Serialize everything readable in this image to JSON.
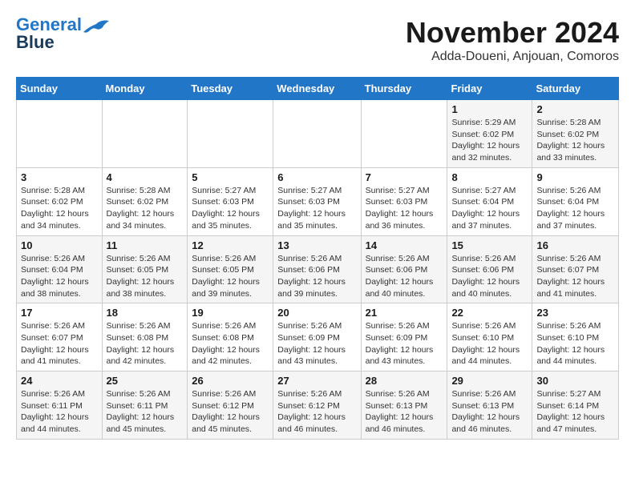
{
  "header": {
    "logo_line1": "General",
    "logo_line2": "Blue",
    "month_title": "November 2024",
    "location": "Adda-Doueni, Anjouan, Comoros"
  },
  "days_of_week": [
    "Sunday",
    "Monday",
    "Tuesday",
    "Wednesday",
    "Thursday",
    "Friday",
    "Saturday"
  ],
  "weeks": [
    [
      {
        "day": "",
        "info": ""
      },
      {
        "day": "",
        "info": ""
      },
      {
        "day": "",
        "info": ""
      },
      {
        "day": "",
        "info": ""
      },
      {
        "day": "",
        "info": ""
      },
      {
        "day": "1",
        "info": "Sunrise: 5:29 AM\nSunset: 6:02 PM\nDaylight: 12 hours and 32 minutes."
      },
      {
        "day": "2",
        "info": "Sunrise: 5:28 AM\nSunset: 6:02 PM\nDaylight: 12 hours and 33 minutes."
      }
    ],
    [
      {
        "day": "3",
        "info": "Sunrise: 5:28 AM\nSunset: 6:02 PM\nDaylight: 12 hours and 34 minutes."
      },
      {
        "day": "4",
        "info": "Sunrise: 5:28 AM\nSunset: 6:02 PM\nDaylight: 12 hours and 34 minutes."
      },
      {
        "day": "5",
        "info": "Sunrise: 5:27 AM\nSunset: 6:03 PM\nDaylight: 12 hours and 35 minutes."
      },
      {
        "day": "6",
        "info": "Sunrise: 5:27 AM\nSunset: 6:03 PM\nDaylight: 12 hours and 35 minutes."
      },
      {
        "day": "7",
        "info": "Sunrise: 5:27 AM\nSunset: 6:03 PM\nDaylight: 12 hours and 36 minutes."
      },
      {
        "day": "8",
        "info": "Sunrise: 5:27 AM\nSunset: 6:04 PM\nDaylight: 12 hours and 37 minutes."
      },
      {
        "day": "9",
        "info": "Sunrise: 5:26 AM\nSunset: 6:04 PM\nDaylight: 12 hours and 37 minutes."
      }
    ],
    [
      {
        "day": "10",
        "info": "Sunrise: 5:26 AM\nSunset: 6:04 PM\nDaylight: 12 hours and 38 minutes."
      },
      {
        "day": "11",
        "info": "Sunrise: 5:26 AM\nSunset: 6:05 PM\nDaylight: 12 hours and 38 minutes."
      },
      {
        "day": "12",
        "info": "Sunrise: 5:26 AM\nSunset: 6:05 PM\nDaylight: 12 hours and 39 minutes."
      },
      {
        "day": "13",
        "info": "Sunrise: 5:26 AM\nSunset: 6:06 PM\nDaylight: 12 hours and 39 minutes."
      },
      {
        "day": "14",
        "info": "Sunrise: 5:26 AM\nSunset: 6:06 PM\nDaylight: 12 hours and 40 minutes."
      },
      {
        "day": "15",
        "info": "Sunrise: 5:26 AM\nSunset: 6:06 PM\nDaylight: 12 hours and 40 minutes."
      },
      {
        "day": "16",
        "info": "Sunrise: 5:26 AM\nSunset: 6:07 PM\nDaylight: 12 hours and 41 minutes."
      }
    ],
    [
      {
        "day": "17",
        "info": "Sunrise: 5:26 AM\nSunset: 6:07 PM\nDaylight: 12 hours and 41 minutes."
      },
      {
        "day": "18",
        "info": "Sunrise: 5:26 AM\nSunset: 6:08 PM\nDaylight: 12 hours and 42 minutes."
      },
      {
        "day": "19",
        "info": "Sunrise: 5:26 AM\nSunset: 6:08 PM\nDaylight: 12 hours and 42 minutes."
      },
      {
        "day": "20",
        "info": "Sunrise: 5:26 AM\nSunset: 6:09 PM\nDaylight: 12 hours and 43 minutes."
      },
      {
        "day": "21",
        "info": "Sunrise: 5:26 AM\nSunset: 6:09 PM\nDaylight: 12 hours and 43 minutes."
      },
      {
        "day": "22",
        "info": "Sunrise: 5:26 AM\nSunset: 6:10 PM\nDaylight: 12 hours and 44 minutes."
      },
      {
        "day": "23",
        "info": "Sunrise: 5:26 AM\nSunset: 6:10 PM\nDaylight: 12 hours and 44 minutes."
      }
    ],
    [
      {
        "day": "24",
        "info": "Sunrise: 5:26 AM\nSunset: 6:11 PM\nDaylight: 12 hours and 44 minutes."
      },
      {
        "day": "25",
        "info": "Sunrise: 5:26 AM\nSunset: 6:11 PM\nDaylight: 12 hours and 45 minutes."
      },
      {
        "day": "26",
        "info": "Sunrise: 5:26 AM\nSunset: 6:12 PM\nDaylight: 12 hours and 45 minutes."
      },
      {
        "day": "27",
        "info": "Sunrise: 5:26 AM\nSunset: 6:12 PM\nDaylight: 12 hours and 46 minutes."
      },
      {
        "day": "28",
        "info": "Sunrise: 5:26 AM\nSunset: 6:13 PM\nDaylight: 12 hours and 46 minutes."
      },
      {
        "day": "29",
        "info": "Sunrise: 5:26 AM\nSunset: 6:13 PM\nDaylight: 12 hours and 46 minutes."
      },
      {
        "day": "30",
        "info": "Sunrise: 5:27 AM\nSunset: 6:14 PM\nDaylight: 12 hours and 47 minutes."
      }
    ]
  ]
}
